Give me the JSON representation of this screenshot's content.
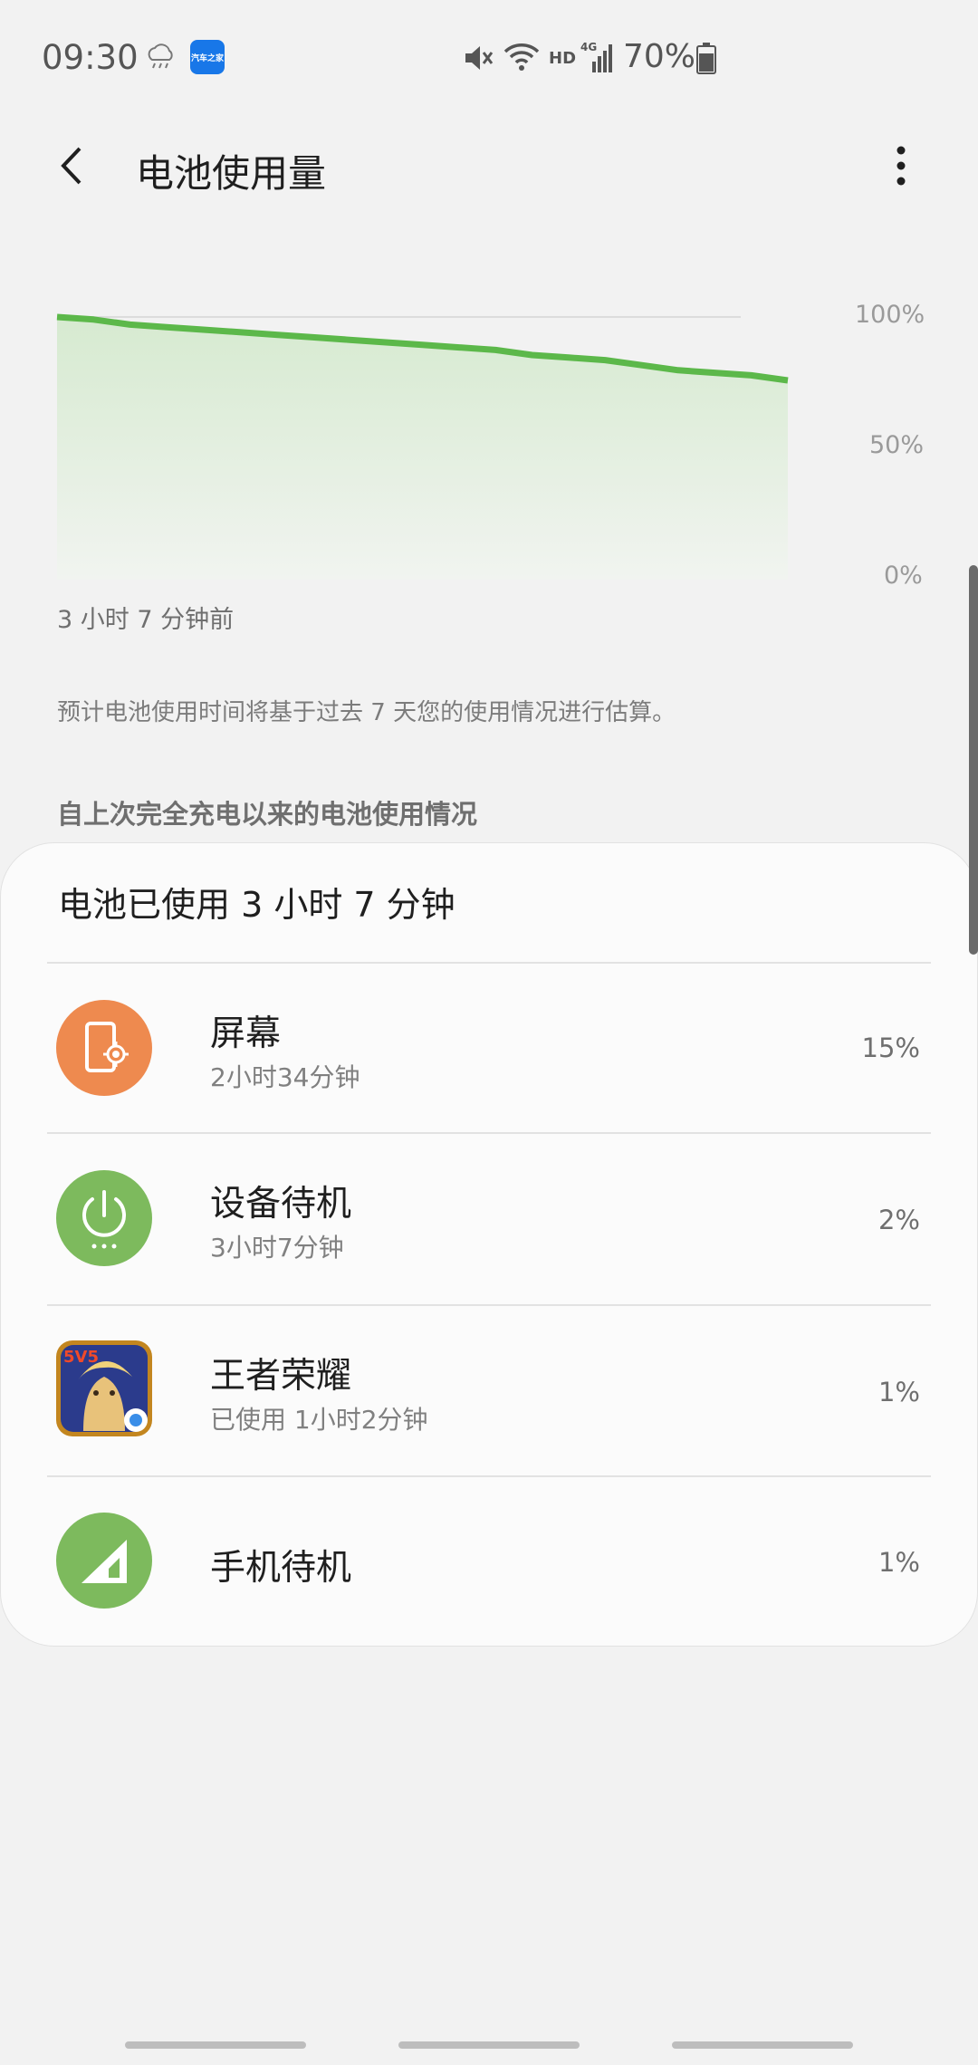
{
  "status_bar": {
    "time": "09:30",
    "weather_icon": "cloud-rain-icon",
    "app_badge_text": "汽车之家",
    "mute_icon": "mute-icon",
    "wifi_icon": "wifi-icon",
    "hd_label": "HD",
    "signal_label": "4G",
    "battery_percent": "70%"
  },
  "header": {
    "title": "电池使用量",
    "back_icon": "chevron-left-icon",
    "more_icon": "more-vertical-icon"
  },
  "chart": {
    "caption": "3 小时 7 分钟前",
    "y_ticks": [
      "100%",
      "50%",
      "0%"
    ]
  },
  "chart_data": {
    "type": "area",
    "x": [
      0,
      1,
      2,
      3,
      4,
      5,
      6,
      7,
      8,
      9,
      10,
      11,
      12,
      13,
      14,
      15,
      16,
      17,
      18,
      19,
      20
    ],
    "values": [
      100,
      99,
      97,
      96,
      95,
      94,
      93,
      92,
      91,
      90,
      89,
      88,
      87,
      85,
      84,
      83,
      81,
      79,
      78,
      77,
      75
    ],
    "ylim": [
      0,
      100
    ],
    "y_tick_labels": [
      "100%",
      "50%",
      "0%"
    ],
    "grid": true,
    "line_color": "#5cb84a",
    "fill_color": "#d9ecd3"
  },
  "estimate_note": "预计电池使用时间将基于过去 7 天您的使用情况进行估算。",
  "section_title": "自上次完全充电以来的电池使用情况",
  "summary": "电池已使用 3 小时 7 分钟",
  "usage": [
    {
      "name": "屏幕",
      "sub": "2小时34分钟",
      "percent": "15%",
      "icon": "screen-brightness-icon",
      "color": "#ee8a4f"
    },
    {
      "name": "设备待机",
      "sub": "3小时7分钟",
      "percent": "2%",
      "icon": "power-icon",
      "color": "#7dba5d"
    },
    {
      "name": "王者荣耀",
      "sub": "已使用 1小时2分钟",
      "percent": "1%",
      "icon": "game-app-icon",
      "color": "#d59a2b"
    },
    {
      "name": "手机待机",
      "sub": "",
      "percent": "1%",
      "icon": "signal-triangle-icon",
      "color": "#7dba5d"
    }
  ]
}
